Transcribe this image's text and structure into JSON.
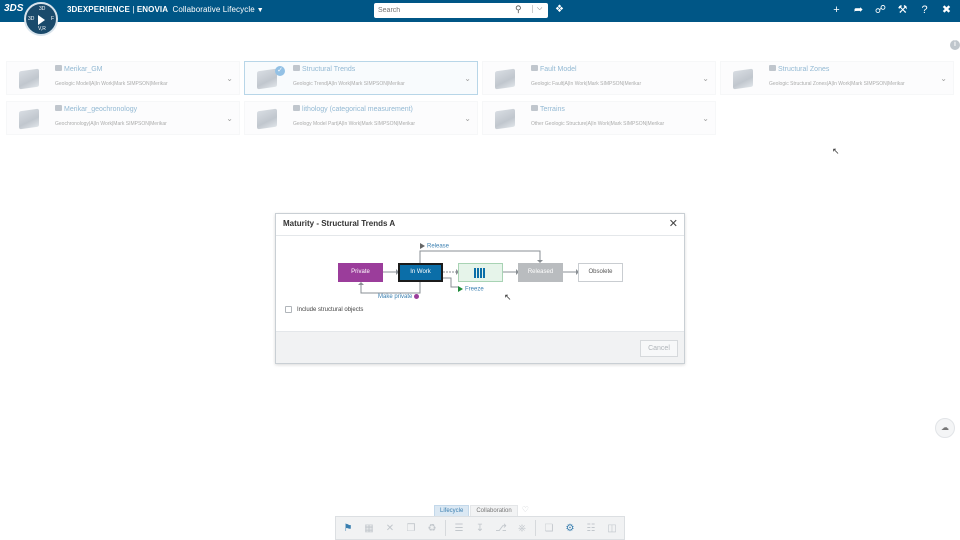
{
  "topbar": {
    "logo": "3DS",
    "compass": {
      "top": "3D",
      "left": "3D",
      "right": "F",
      "bottom": "V,R"
    },
    "brand_3dx": "3DEXPERIENCE",
    "brand_sep": " | ",
    "brand_enovia": "ENOVIA",
    "app_title": "Collaborative Lifecycle",
    "search_placeholder": "Search",
    "icons": [
      "tag-icon",
      "plus-icon",
      "share-icon",
      "network-icon",
      "tools-icon",
      "help-icon",
      "collapse-icon"
    ]
  },
  "tiles": [
    {
      "title": "Merikar_GM",
      "subtitle": "Geologic Model|A|In Work|Mark SIMPSON|Merikar",
      "selected": false
    },
    {
      "title": "Structural Trends",
      "subtitle": "Geologic Trend|A|In Work|Mark SIMPSON|Merikar",
      "selected": true
    },
    {
      "title": "Fault Model",
      "subtitle": "Geologic Fault|A|In Work|Mark SIMPSON|Merikar",
      "selected": false
    },
    {
      "title": "Structural Zones",
      "subtitle": "Geologic Structural Zones|A|In Work|Mark SIMPSON|Merikar",
      "selected": false
    },
    {
      "title": "Merikar_geochronology",
      "subtitle": "Geochronology|A|In Work|Mark SIMPSON|Merikar",
      "selected": false
    },
    {
      "title": "lithology (categorical measurement)",
      "subtitle": "Geology Model Part|A|In Work|Mark SIMPSON|Merikar",
      "selected": false
    },
    {
      "title": "Terrains",
      "subtitle": "Other Geologic Structure|A|In Work|Mark SIMPSON|Merikar",
      "selected": false
    }
  ],
  "dialog": {
    "title": "Maturity - Structural Trends A",
    "states": {
      "private": "Private",
      "in_work": "In Work",
      "released": "Released",
      "obsolete": "Obsolete"
    },
    "transitions": {
      "release": "Release",
      "freeze": "Freeze",
      "make_private": "Make private"
    },
    "include_label": "Include structural objects",
    "cancel_label": "Cancel"
  },
  "bottom": {
    "tabs": [
      "Lifecycle",
      "Collaboration"
    ],
    "active_tab": "Lifecycle"
  },
  "colors": {
    "topbar": "#005686",
    "private": "#9b3d9b",
    "in_work": "#0b6ea8",
    "frozen": "#e6f4ea",
    "released": "#b9bcbf",
    "link": "#3a7fb0"
  }
}
